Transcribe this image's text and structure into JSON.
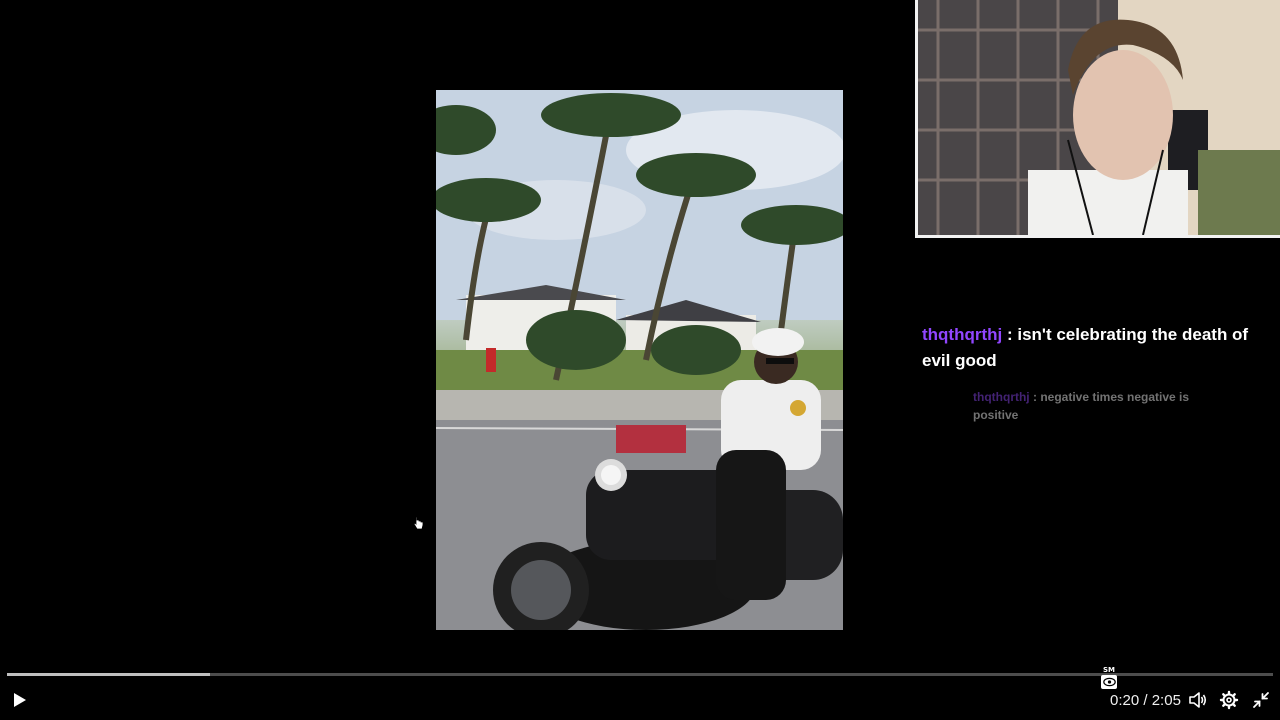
{
  "chat": {
    "messages": [
      {
        "user": "thqthqrthj",
        "separator": " : ",
        "text": "isn't celebrating the death of evil good"
      },
      {
        "user": "thqthqrthj",
        "separator": " : ",
        "text": "negative times negative is positive"
      }
    ]
  },
  "overlay": {
    "tiny_label": "SM"
  },
  "controls": {
    "current_time": "0:20",
    "time_separator": " / ",
    "duration": "2:05",
    "progress_fraction": 0.16,
    "icons": {
      "play": "play-icon",
      "volume": "volume-icon",
      "settings": "gear-icon",
      "exit_fullscreen": "exit-fullscreen-icon",
      "visibility": "eye-icon"
    }
  },
  "colors": {
    "username": "#9146ff",
    "progress_fill": "#bfbfbf",
    "progress_track": "#4d4d4d",
    "background": "#000000"
  }
}
